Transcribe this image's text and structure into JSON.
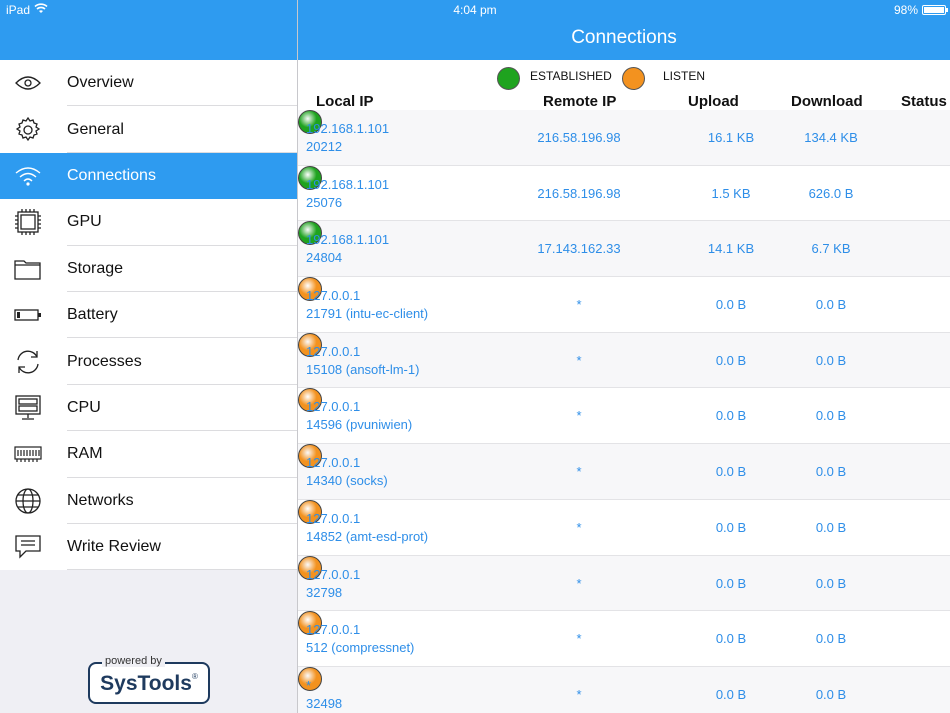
{
  "status_bar": {
    "device": "iPad",
    "time": "4:04 pm",
    "battery": "98%",
    "battery_level": 0.98
  },
  "nav": {
    "title": "Connections"
  },
  "sidebar": {
    "items": [
      {
        "label": "Overview",
        "icon": "eye-icon"
      },
      {
        "label": "General",
        "icon": "gear-icon"
      },
      {
        "label": "Connections",
        "icon": "wifi-icon",
        "active": true
      },
      {
        "label": "GPU",
        "icon": "chip-icon"
      },
      {
        "label": "Storage",
        "icon": "folder-icon"
      },
      {
        "label": "Battery",
        "icon": "battery-icon"
      },
      {
        "label": "Processes",
        "icon": "refresh-icon"
      },
      {
        "label": "CPU",
        "icon": "server-icon"
      },
      {
        "label": "RAM",
        "icon": "ram-icon"
      },
      {
        "label": "Networks",
        "icon": "globe-icon"
      },
      {
        "label": "Write Review",
        "icon": "chat-icon"
      }
    ],
    "powered_by": "powered by",
    "brand": "SysTools",
    "registered": "®"
  },
  "legend": {
    "established": "ESTABLISHED",
    "listen": "LISTEN",
    "established_color": "#1fa31f",
    "listen_color": "#f3921f"
  },
  "table": {
    "headers": {
      "local": "Local IP",
      "remote": "Remote IP",
      "upload": "Upload",
      "download": "Download",
      "status": "Status"
    },
    "rows": [
      {
        "ip": "192.168.1.101",
        "port": "20212",
        "remote": "216.58.196.98",
        "upload": "16.1 KB",
        "download": "134.4 KB",
        "status": "established"
      },
      {
        "ip": "192.168.1.101",
        "port": "25076",
        "remote": "216.58.196.98",
        "upload": "1.5 KB",
        "download": "626.0 B",
        "status": "established"
      },
      {
        "ip": "192.168.1.101",
        "port": "24804",
        "remote": "17.143.162.33",
        "upload": "14.1 KB",
        "download": "6.7 KB",
        "status": "established"
      },
      {
        "ip": "127.0.0.1",
        "port": "21791 (intu-ec-client)",
        "remote": "*",
        "upload": "0.0 B",
        "download": "0.0 B",
        "status": "listen"
      },
      {
        "ip": "127.0.0.1",
        "port": "15108 (ansoft-lm-1)",
        "remote": "*",
        "upload": "0.0 B",
        "download": "0.0 B",
        "status": "listen"
      },
      {
        "ip": "127.0.0.1",
        "port": "14596 (pvuniwien)",
        "remote": "*",
        "upload": "0.0 B",
        "download": "0.0 B",
        "status": "listen"
      },
      {
        "ip": "127.0.0.1",
        "port": "14340 (socks)",
        "remote": "*",
        "upload": "0.0 B",
        "download": "0.0 B",
        "status": "listen"
      },
      {
        "ip": "127.0.0.1",
        "port": "14852 (amt-esd-prot)",
        "remote": "*",
        "upload": "0.0 B",
        "download": "0.0 B",
        "status": "listen"
      },
      {
        "ip": "127.0.0.1",
        "port": "32798",
        "remote": "*",
        "upload": "0.0 B",
        "download": "0.0 B",
        "status": "listen"
      },
      {
        "ip": "127.0.0.1",
        "port": "512 (compressnet)",
        "remote": "*",
        "upload": "0.0 B",
        "download": "0.0 B",
        "status": "listen"
      },
      {
        "ip": "*",
        "port": "32498",
        "remote": "*",
        "upload": "0.0 B",
        "download": "0.0 B",
        "status": "listen"
      }
    ]
  }
}
